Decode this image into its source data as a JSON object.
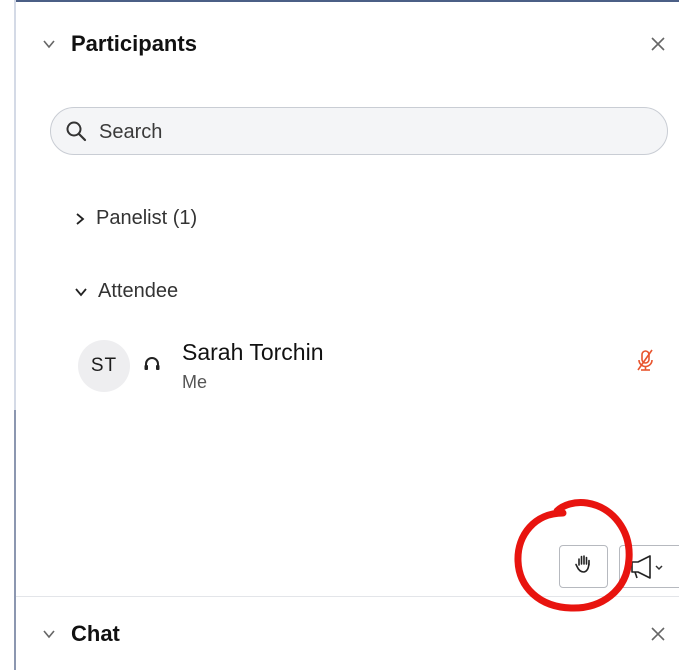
{
  "participants_panel": {
    "title": "Participants",
    "chevron_icon": "chevron-down-icon",
    "close_icon": "close-icon"
  },
  "search": {
    "placeholder": "Search",
    "value": "",
    "icon": "search-icon"
  },
  "groups": [
    {
      "label": "Panelist (1)",
      "expanded": false
    },
    {
      "label": "Attendee",
      "expanded": true
    }
  ],
  "participants": [
    {
      "initials": "ST",
      "name": "Sarah Torchin",
      "subtitle": "Me",
      "audio_icon": "headset-icon",
      "mic_icon": "microphone-muted-icon",
      "mic_color": "#e8552f"
    }
  ],
  "footer_buttons": {
    "raise_hand_icon": "raise-hand-icon",
    "announce_icon": "megaphone-icon"
  },
  "chat_panel": {
    "title": "Chat",
    "chevron_icon": "chevron-down-icon",
    "close_icon": "close-icon"
  },
  "annotation": {
    "color": "#e8140f",
    "shape": "hand-drawn-circle"
  }
}
